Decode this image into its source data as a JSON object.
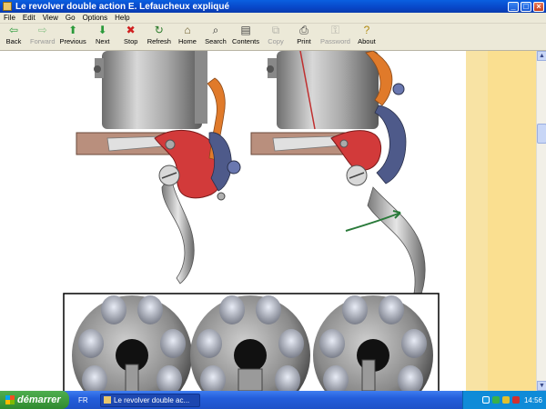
{
  "window": {
    "title": "Le revolver double action E. Lefaucheux expliqué",
    "minimize_glyph": "_",
    "maximize_glyph": "□",
    "close_glyph": "×"
  },
  "menubar": {
    "items": [
      "File",
      "Edit",
      "View",
      "Go",
      "Options",
      "Help"
    ]
  },
  "toolbar": {
    "buttons": [
      {
        "label": "Back",
        "icon": "back-arrow-icon",
        "glyph": "⇦",
        "color": "#2a9a3a",
        "enabled": true
      },
      {
        "label": "Forward",
        "icon": "forward-arrow-icon",
        "glyph": "⇨",
        "color": "#2a9a3a",
        "enabled": false
      },
      {
        "label": "Previous",
        "icon": "up-arrow-icon",
        "glyph": "⬆",
        "color": "#2a9a3a",
        "enabled": true
      },
      {
        "label": "Next",
        "icon": "down-arrow-icon",
        "glyph": "⬇",
        "color": "#2a9a3a",
        "enabled": true
      },
      {
        "label": "Stop",
        "icon": "stop-icon",
        "glyph": "✖",
        "color": "#d02020",
        "enabled": true
      },
      {
        "label": "Refresh",
        "icon": "refresh-icon",
        "glyph": "↻",
        "color": "#2a7a2a",
        "enabled": true
      },
      {
        "label": "Home",
        "icon": "home-icon",
        "glyph": "⌂",
        "color": "#6a5a2a",
        "enabled": true
      },
      {
        "label": "Search",
        "icon": "search-icon",
        "glyph": "⌕",
        "color": "#333333",
        "enabled": true
      },
      {
        "label": "Contents",
        "icon": "contents-icon",
        "glyph": "▤",
        "color": "#444444",
        "enabled": true
      },
      {
        "label": "Copy",
        "icon": "copy-icon",
        "glyph": "⧉",
        "color": "#777777",
        "enabled": false
      },
      {
        "label": "Print",
        "icon": "print-icon",
        "glyph": "⎙",
        "color": "#333333",
        "enabled": true
      },
      {
        "label": "Password",
        "icon": "key-icon",
        "glyph": "⚿",
        "color": "#777777",
        "enabled": false
      },
      {
        "label": "About",
        "icon": "about-icon",
        "glyph": "?",
        "color": "#b08a10",
        "enabled": true
      }
    ]
  },
  "colors": {
    "titlebar": "#0846c8",
    "chrome": "#ece9d8",
    "right_margin": "#fadf90",
    "hammer_red": "#d23a3a",
    "spring_orange": "#e07a2a",
    "steel": "#b0b0b0"
  },
  "taskbar": {
    "start_label": "démarrer",
    "language": "FR",
    "task_title": "Le revolver double ac...",
    "clock": "14:56"
  }
}
